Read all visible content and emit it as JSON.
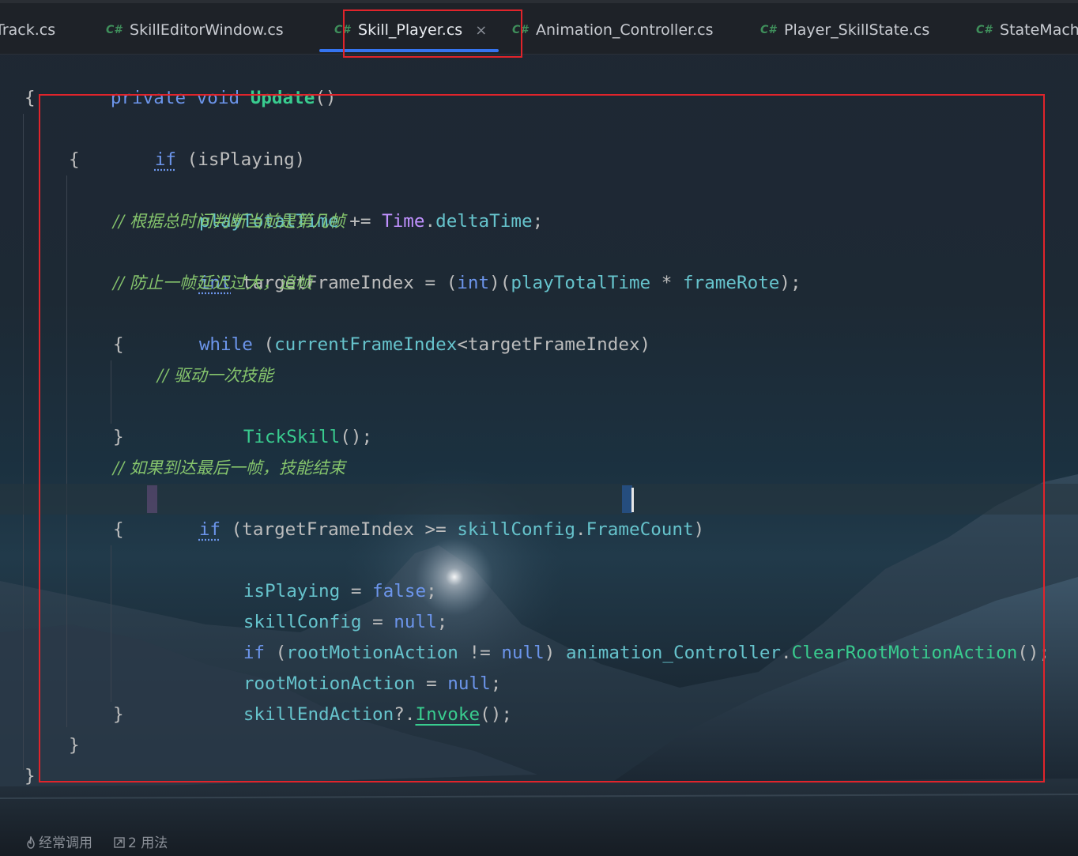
{
  "tabs": [
    {
      "label": "Track.cs",
      "icon": "csharp-file-icon",
      "active": false
    },
    {
      "label": "SkillEditorWindow.cs",
      "icon": "csharp-file-icon",
      "active": false
    },
    {
      "label": "Skill_Player.cs",
      "icon": "csharp-file-icon",
      "active": true
    },
    {
      "label": "Animation_Controller.cs",
      "icon": "csharp-file-icon",
      "active": false
    },
    {
      "label": "Player_SkillState.cs",
      "icon": "csharp-file-icon",
      "active": false
    },
    {
      "label": "StateMach",
      "icon": "csharp-file-icon",
      "active": false
    }
  ],
  "cs_icon_text": "C#",
  "close_icon_text": "×",
  "code": {
    "line1": {
      "a": "private",
      "b": " ",
      "c": "void",
      "d": " ",
      "e": "Update",
      "f": "()"
    },
    "line2": {
      "a": "{"
    },
    "line3": {
      "a": "if",
      "b": " (isPlaying)"
    },
    "line4": {
      "a": "{"
    },
    "line5": {
      "a": "playTotalTime",
      "b": " += ",
      "c": "Time",
      "d": ".",
      "e": "deltaTime",
      "f": ";"
    },
    "line6": {
      "a": "// 根据总时间判断当前是第几帧"
    },
    "line7": {
      "a": "int",
      "b": " targetFrameIndex = (",
      "c": "int",
      "d": ")(",
      "e": "playTotalTime",
      "f": " * ",
      "g": "frameRote",
      "h": ");"
    },
    "line8": {
      "a": "// 防止一帧延迟过大，追帧"
    },
    "line9": {
      "a": "while",
      "b": " (",
      "c": "currentFrameIndex",
      "d": "<targetFrameIndex)"
    },
    "line10": {
      "a": "{"
    },
    "line11": {
      "a": "// 驱动一次技能"
    },
    "line12": {
      "a": "TickSkill",
      "b": "();"
    },
    "line13": {
      "a": "}"
    },
    "line14": {
      "a": "// 如果到达最后一帧，技能结束"
    },
    "line15": {
      "a": "if",
      "b": " ",
      "c": "(",
      "d": "targetFrameIndex >= ",
      "e": "skillConfig",
      "f": ".",
      "g": "FrameCount",
      "h": ")"
    },
    "line16": {
      "a": "{"
    },
    "line17": {
      "a": "isPlaying",
      "b": " = ",
      "c": "false",
      "d": ";"
    },
    "line18": {
      "a": "skillConfig",
      "b": " = ",
      "c": "null",
      "d": ";"
    },
    "line19": {
      "a": "if",
      "b": " (",
      "c": "rootMotionAction",
      "d": " != ",
      "e": "null",
      "f": ") ",
      "g": "animation_Controller",
      "h": ".",
      "i": "ClearRootMotionAction",
      "j": "();"
    },
    "line20": {
      "a": "rootMotionAction",
      "b": " = ",
      "c": "null",
      "d": ";"
    },
    "line21": {
      "a": "skillEndAction",
      "b": "?.",
      "c": "Invoke",
      "d": "();"
    },
    "line22": {
      "a": "}"
    },
    "line23": {
      "a": "}"
    },
    "line24": {
      "a": "}"
    }
  },
  "footer": {
    "frequent_icon": "flame-icon",
    "frequent_label": "经常调用",
    "usages_icon": "usages-icon",
    "usages_label": "2 用法"
  },
  "colors": {
    "keyword": "#6c95eb",
    "method": "#39cc8f",
    "field": "#66c3cc",
    "class": "#c191ff",
    "comment": "#85c46c",
    "highlight_box": "#e0242b",
    "active_tab_underline": "#3574f0"
  }
}
